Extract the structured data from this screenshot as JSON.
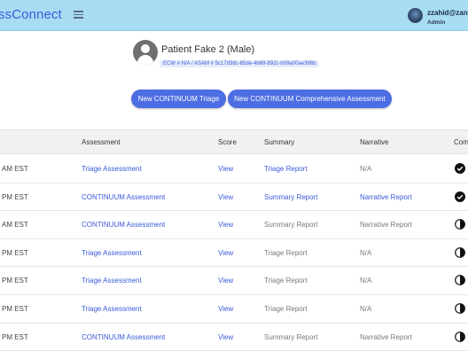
{
  "header": {
    "brand": "ssConnect",
    "user_name": "zzahid@zane",
    "user_role": "Admin"
  },
  "patient": {
    "name": "Patient Fake 2 (Male)",
    "ids": "ECW # N/A / ASAM # 5c17d38c-65de-4b69-892c-b09a00ae396b"
  },
  "actions": {
    "new_triage": "New CONTINUUM Triage",
    "new_comprehensive": "New CONTINUUM Comprehensive Assessment"
  },
  "table": {
    "columns": [
      "Assessment",
      "Score",
      "Summary",
      "Narrative",
      "Com"
    ],
    "rows": [
      {
        "date": "AM EST",
        "assessment": "Triage Assessment",
        "score": "View",
        "summary": "Triage Report",
        "summary_active": true,
        "narrative": "N/A",
        "narrative_active": false,
        "status": "complete"
      },
      {
        "date": "PM EST",
        "assessment": "CONTINUUM Assessment",
        "score": "View",
        "summary": "Summary Report",
        "summary_active": true,
        "narrative": "Narrative Report",
        "narrative_active": true,
        "status": "complete"
      },
      {
        "date": "AM EST",
        "assessment": "CONTINUUM Assessment",
        "score": "View",
        "summary": "Summary Report",
        "summary_active": false,
        "narrative": "Narrative Report",
        "narrative_active": false,
        "status": "partial"
      },
      {
        "date": "PM EST",
        "assessment": "Triage Assessment",
        "score": "View",
        "summary": "Triage Report",
        "summary_active": false,
        "narrative": "N/A",
        "narrative_active": false,
        "status": "partial"
      },
      {
        "date": "PM EST",
        "assessment": "Triage Assessment",
        "score": "View",
        "summary": "Triage Report",
        "summary_active": false,
        "narrative": "N/A",
        "narrative_active": false,
        "status": "partial"
      },
      {
        "date": "PM EST",
        "assessment": "Triage Assessment",
        "score": "View",
        "summary": "Triage Report",
        "summary_active": false,
        "narrative": "N/A",
        "narrative_active": false,
        "status": "partial"
      },
      {
        "date": "PM EST",
        "assessment": "CONTINUUM Assessment",
        "score": "View",
        "summary": "Summary Report",
        "summary_active": false,
        "narrative": "Narrative Report",
        "narrative_active": false,
        "status": "partial"
      }
    ]
  },
  "colors": {
    "topbar": "#a8dcf3",
    "brand": "#3b5bd9",
    "button": "#4d6de3",
    "link": "#3b5bd9",
    "muted": "#7a7a7a"
  }
}
